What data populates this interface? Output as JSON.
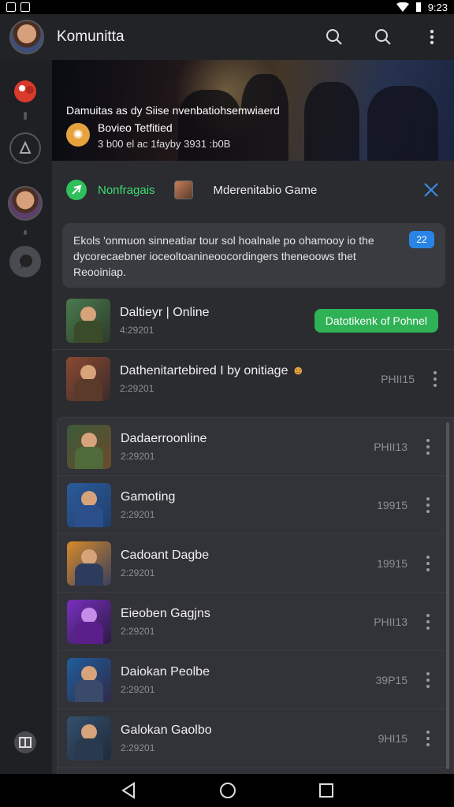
{
  "status": {
    "time": "9:23"
  },
  "appbar": {
    "title": "Komunitta"
  },
  "banner": {
    "line1": "Damuitas as dy Siise nvenbatiohsemwiaerd",
    "line2": "Bovieo Tetfitied",
    "line3": "3 b00 el ac 1fayby 3931 :b0B"
  },
  "notification": {
    "label": "Nonfragais",
    "game": "Mderenitabio Game"
  },
  "message": {
    "text": "Ekols 'onmuon sinneatiar tour sol hoalnale po ohamooy io the dycorecaebner ioceoltoanineoocordingers theneoows thet Reooiniap.",
    "badge": "22"
  },
  "top_rows": [
    {
      "name": "Daltieyr | Online",
      "sub": "4:29201",
      "action": "Datotikenk of Pohnel",
      "thumb": "#4a7a4e"
    },
    {
      "name": "Dathenitartebired I by onitiage",
      "sub": "2:29201",
      "meta": "PHII15",
      "thumb": "#8a4a32"
    }
  ],
  "list": [
    {
      "name": "Dadaerroonline",
      "sub": "2:29201",
      "meta": "PHII13",
      "c1": "#3b5a3a",
      "c2": "#6b4a2a"
    },
    {
      "name": "Gamoting",
      "sub": "2:29201",
      "meta": "19915",
      "c1": "#2c5b9a",
      "c2": "#1f3f6b"
    },
    {
      "name": "Cadoant Dagbe",
      "sub": "2:29201",
      "meta": "19915",
      "c1": "#d68a2a",
      "c2": "#3b3f5a"
    },
    {
      "name": "Eieoben Gagjns",
      "sub": "2:29201",
      "meta": "PHII13",
      "c1": "#7a2fc0",
      "c2": "#2a1b45"
    },
    {
      "name": "Daiokan Peolbe",
      "sub": "2:29201",
      "meta": "39P15",
      "c1": "#1f5e9c",
      "c2": "#2f2a48"
    },
    {
      "name": "Galokan Gaolbo",
      "sub": "2:29201",
      "meta": "9HI15",
      "c1": "#34506e",
      "c2": "#1e2a3a"
    }
  ]
}
